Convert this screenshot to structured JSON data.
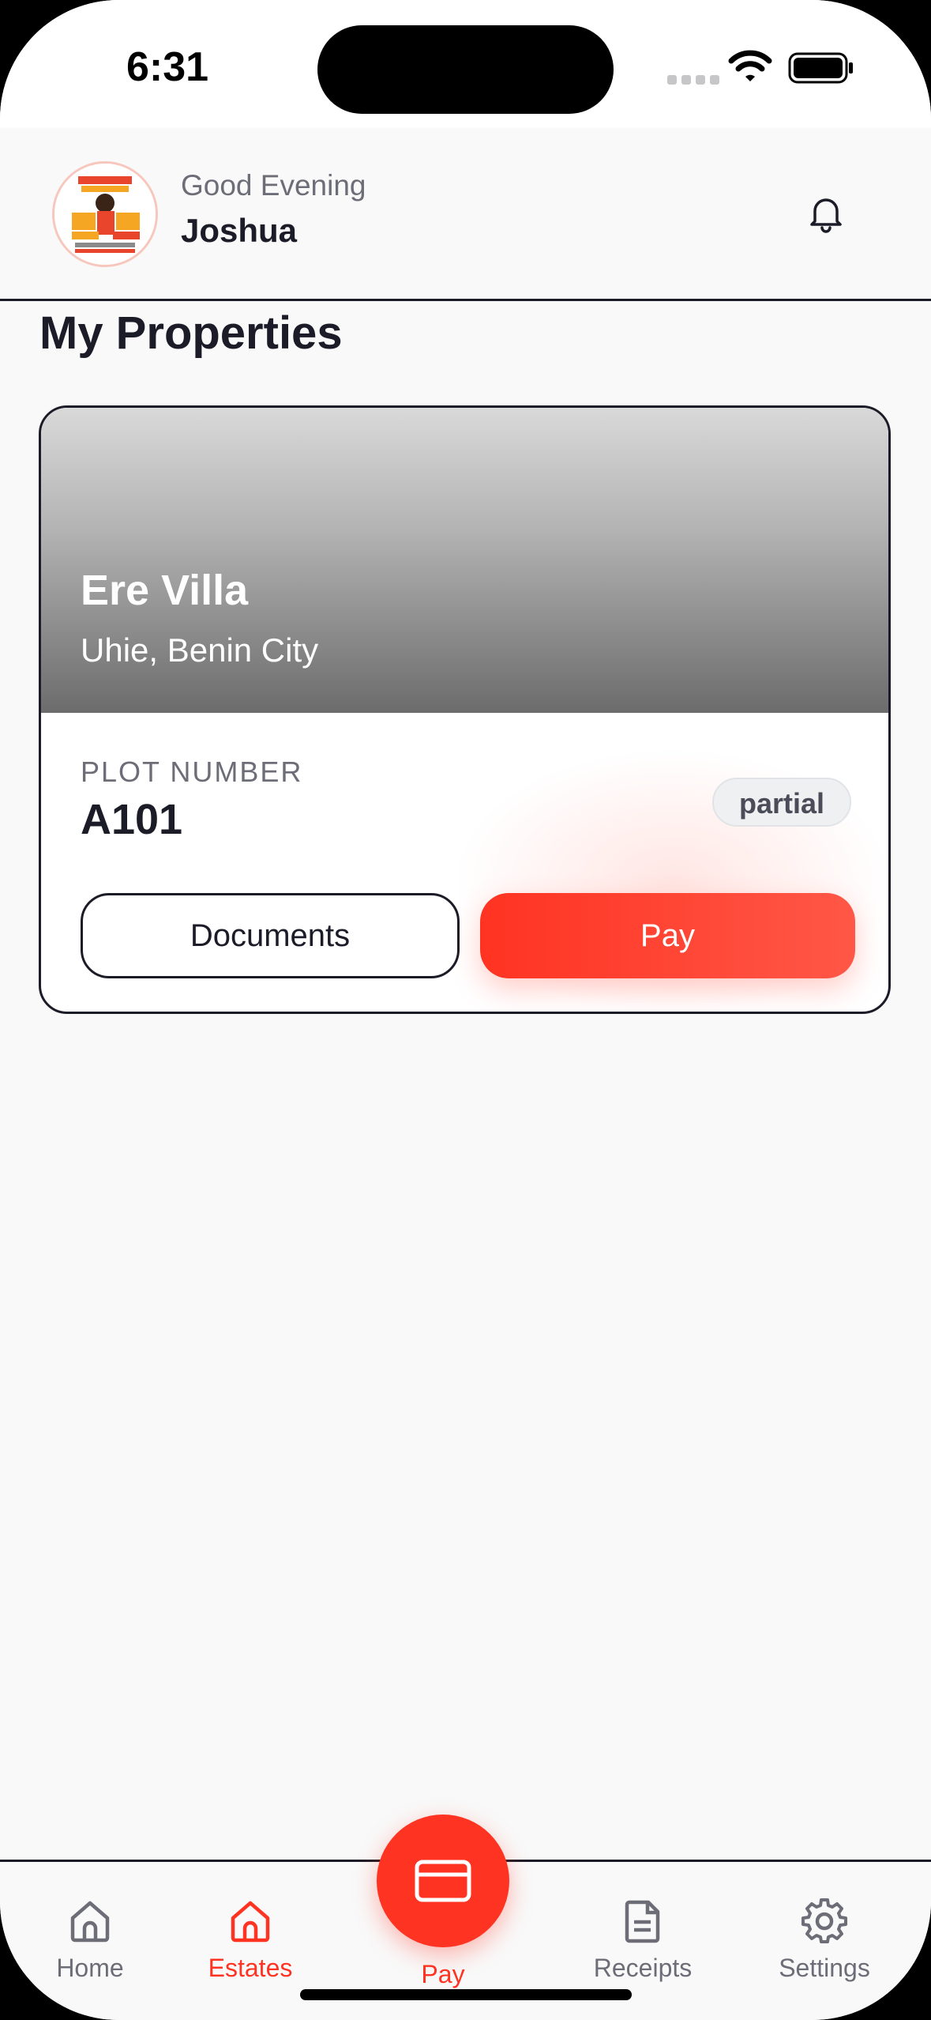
{
  "status_bar": {
    "time": "6:31"
  },
  "header": {
    "greeting": "Good Evening",
    "user_name": "Joshua"
  },
  "section_title": "My Properties",
  "property_card": {
    "estate_name": "Ere Villa",
    "location": "Uhie, Benin City",
    "plot_label": "PLOT NUMBER",
    "plot_number": "A101",
    "status": "partial",
    "documents_label": "Documents",
    "pay_label": "Pay"
  },
  "tab_bar": {
    "items": [
      {
        "label": "Home",
        "icon": "home-icon",
        "active": false
      },
      {
        "label": "Estates",
        "icon": "home-icon",
        "active": true
      },
      {
        "label": "Pay",
        "icon": "credit-card-icon",
        "active": false
      },
      {
        "label": "Receipts",
        "icon": "document-icon",
        "active": false
      },
      {
        "label": "Settings",
        "icon": "gear-icon",
        "active": false
      }
    ]
  },
  "colors": {
    "accent": "#ff3322",
    "text_primary": "#1c1c28",
    "text_secondary": "#6d6d78",
    "background": "#f9f9f9"
  }
}
